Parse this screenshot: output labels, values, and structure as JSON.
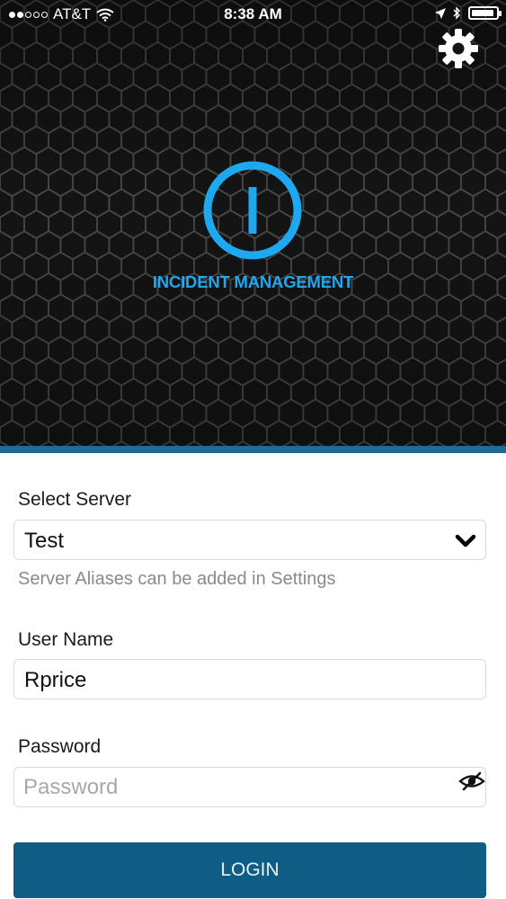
{
  "status_bar": {
    "carrier": "AT&T",
    "time": "8:38 AM"
  },
  "icons": {
    "settings": "gear-icon",
    "logo": "incident-logo-icon",
    "server_dropdown": "chevron-down-icon",
    "password_visibility": "eye-slash-icon"
  },
  "header": {
    "app_title": "INCIDENT MANAGEMENT"
  },
  "form": {
    "server_label": "Select Server",
    "server_value": "Test",
    "server_hint": "Server Aliases can be added in Settings",
    "username_label": "User Name",
    "username_value": "Rprice",
    "password_label": "Password",
    "password_placeholder": "Password",
    "password_value": ""
  },
  "login_button": {
    "label": "LOGIN"
  },
  "colors": {
    "accent_blue": "#1ea8f0",
    "button_blue": "#0f5c84",
    "divider_blue": "#1f6b96",
    "hero_background": "#0f0f0f"
  }
}
